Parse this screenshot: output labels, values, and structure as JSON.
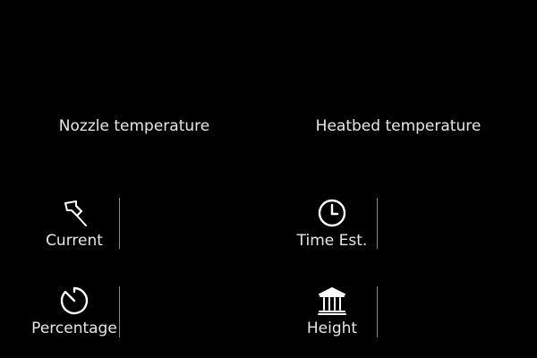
{
  "temperatures": {
    "nozzle_label": "Nozzle temperature",
    "heatbed_label": "Heatbed temperature"
  },
  "stats": {
    "current": {
      "label": "Current",
      "icon": "pin-icon"
    },
    "percentage": {
      "label": "Percentage",
      "icon": "gauge-icon"
    },
    "time": {
      "label": "Time Est.",
      "icon": "clock-icon"
    },
    "height": {
      "label": "Height",
      "icon": "building-icon"
    }
  },
  "colors": {
    "background": "#000000",
    "text": "#e6e6e6",
    "divider": "#8a8a8a"
  }
}
